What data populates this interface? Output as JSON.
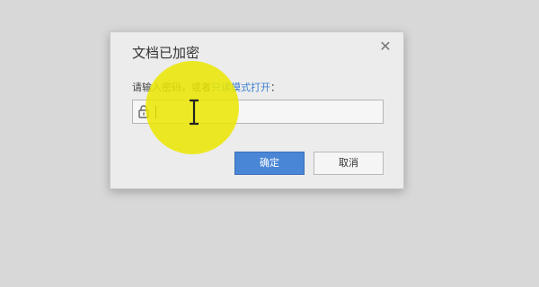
{
  "dialog": {
    "title": "文档已加密",
    "close_glyph": "✕",
    "prompt_text": "请输入密码，或者",
    "prompt_link": "只读模式打开",
    "prompt_suffix": "：",
    "password": {
      "value": "",
      "placeholder": ""
    },
    "lock_icon": "lock-icon",
    "ok_label": "确定",
    "cancel_label": "取消"
  },
  "colors": {
    "background": "#d8d8d8",
    "dialog_bg": "#ececec",
    "accent_blue": "#4a86d6",
    "link_blue": "#3a7fd0",
    "highlight_yellow": "#ebe800"
  }
}
